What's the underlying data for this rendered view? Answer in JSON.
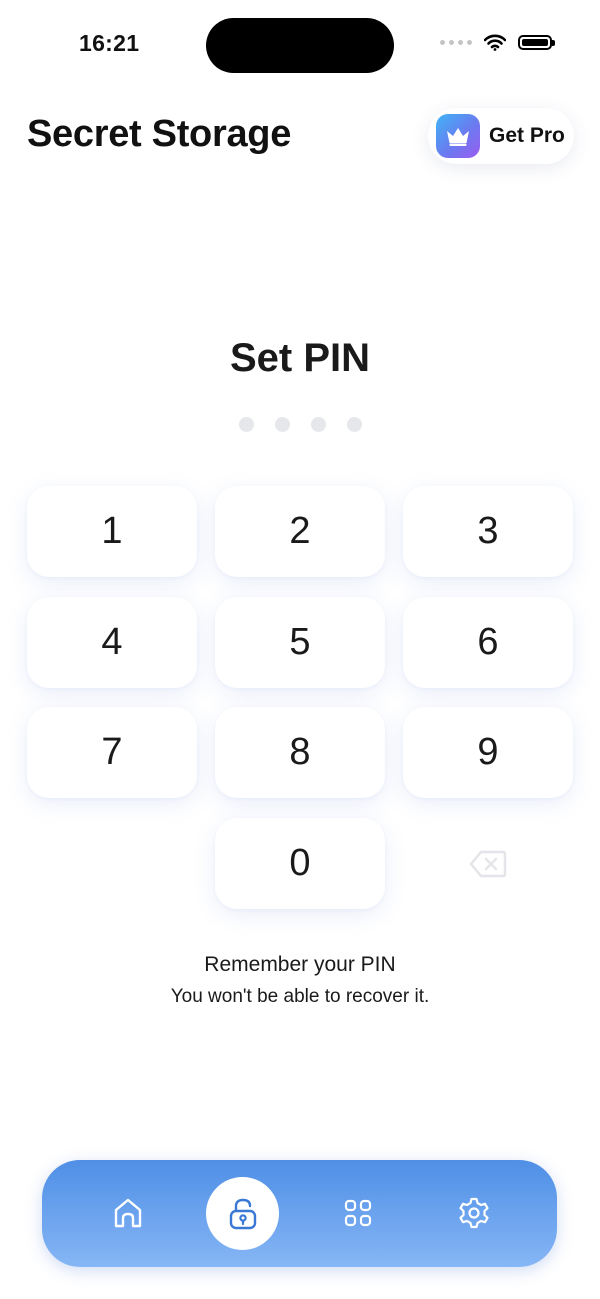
{
  "status_bar": {
    "time": "16:21"
  },
  "header": {
    "title": "Secret Storage",
    "pro_button_label": "Get Pro"
  },
  "pin": {
    "title": "Set PIN",
    "digits_entered": 0,
    "digits_total": 4
  },
  "keypad": {
    "keys": [
      "1",
      "2",
      "3",
      "4",
      "5",
      "6",
      "7",
      "8",
      "9",
      "0"
    ]
  },
  "hint": {
    "title": "Remember your PIN",
    "subtitle": "You won't be able to recover it."
  },
  "tabbar": {
    "items": [
      "home-icon",
      "lock-icon",
      "apps-grid-icon",
      "gear-icon"
    ],
    "active": "lock-icon"
  },
  "colors": {
    "tabbar_top": "#4f8fe6",
    "tabbar_bottom": "#86b6f5",
    "active_icon": "#3a78d6",
    "pin_dot": "#e6e7ea"
  }
}
